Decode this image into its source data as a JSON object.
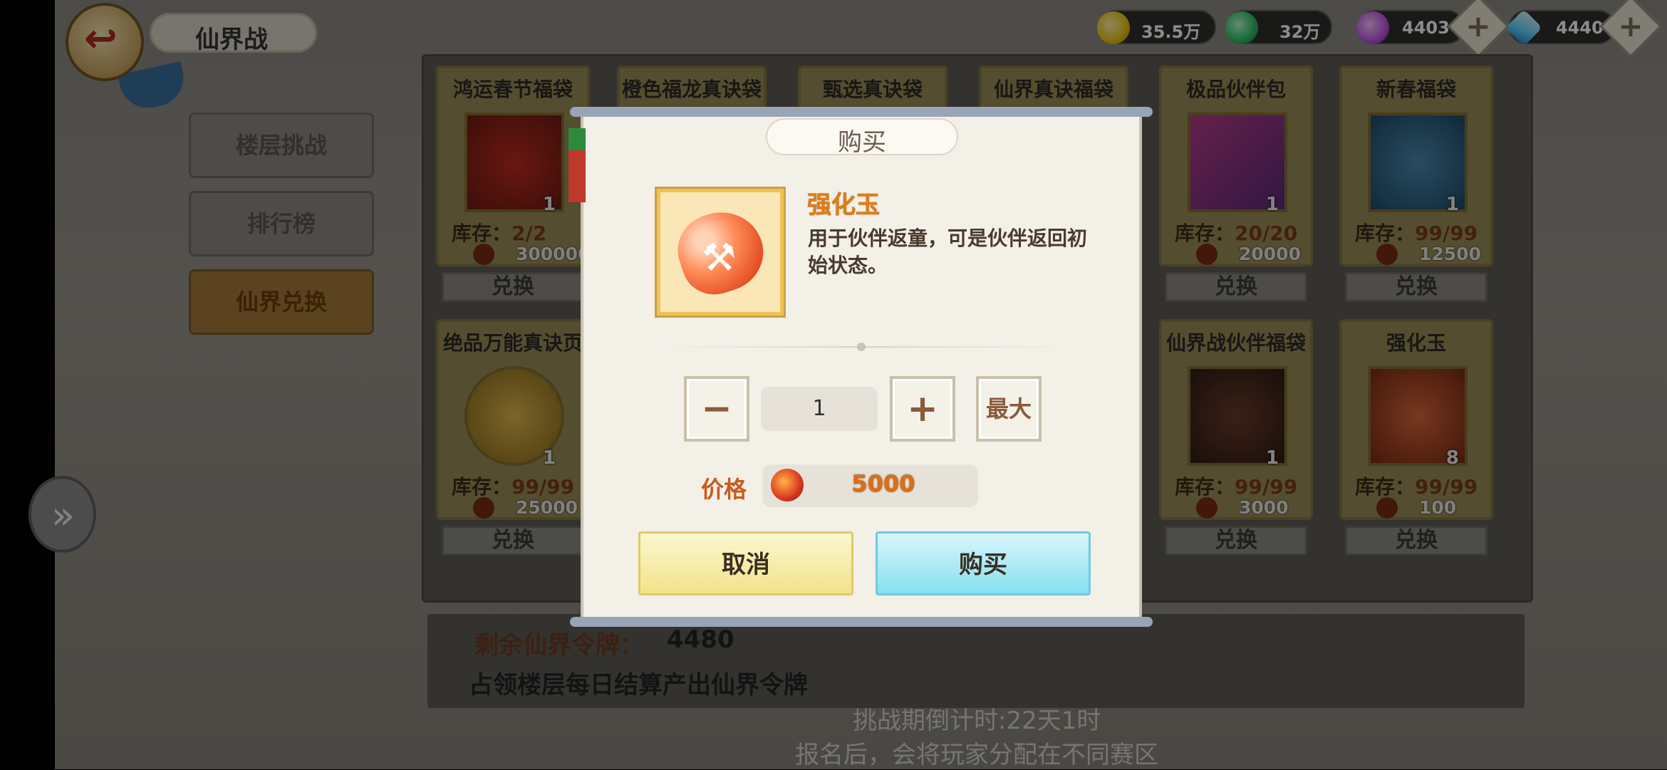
{
  "header": {
    "title": "仙界战"
  },
  "resources": [
    {
      "name": "gold",
      "value": "35.5万",
      "icon": "gold-coin-icon",
      "color": "#f2c81a"
    },
    {
      "name": "gem",
      "value": "32万",
      "icon": "green-gem-icon",
      "color": "#35c46a"
    },
    {
      "name": "orb",
      "value": "4403",
      "icon": "purple-orb-icon",
      "color": "#c65be8"
    },
    {
      "name": "diamond",
      "value": "4440",
      "icon": "diamond-icon",
      "color": "#5fd3ff"
    }
  ],
  "plus_label": "+",
  "sidebar": {
    "items": [
      {
        "label": "楼层挑战"
      },
      {
        "label": "排行榜"
      },
      {
        "label": "仙界兑换"
      }
    ]
  },
  "shop": {
    "stock_label": "库存：",
    "exchange_label": "兑换",
    "items": [
      {
        "name": "鸿运春节福袋",
        "count": "1",
        "stock": "2/2",
        "price": "300000"
      },
      {
        "name": "橙色福龙真诀袋"
      },
      {
        "name": "甄选真诀袋"
      },
      {
        "name": "仙界真诀福袋"
      },
      {
        "name": "极品伙伴包",
        "count": "1",
        "stock": "20/20",
        "price": "20000"
      },
      {
        "name": "新春福袋",
        "count": "1",
        "stock": "99/99",
        "price": "12500"
      },
      {
        "name": "绝品万能真诀页",
        "count": "1",
        "stock": "99/99",
        "price": "25000"
      },
      {
        "name": "仙界战伙伴福袋",
        "count": "1",
        "stock": "99/99",
        "price": "3000"
      },
      {
        "name": "强化玉",
        "count": "8",
        "stock": "99/99",
        "price": "100"
      }
    ]
  },
  "info": {
    "tokens_label": "剩余仙界令牌：",
    "tokens_value": "4480",
    "tip": "占领楼层每日结算产出仙界令牌",
    "countdown": "挑战期倒计时:22天1时",
    "tip2": "报名后，会将玩家分配在不同赛区"
  },
  "modal": {
    "title": "购买",
    "item_name": "强化玉",
    "item_desc": "用于伙伴返童，可是伙伴返回初始状态。",
    "minus": "−",
    "quantity": "1",
    "plus": "+",
    "max_label": "最大",
    "price_label": "价格",
    "price_value": "5000",
    "cancel_label": "取消",
    "buy_label": "购买"
  }
}
